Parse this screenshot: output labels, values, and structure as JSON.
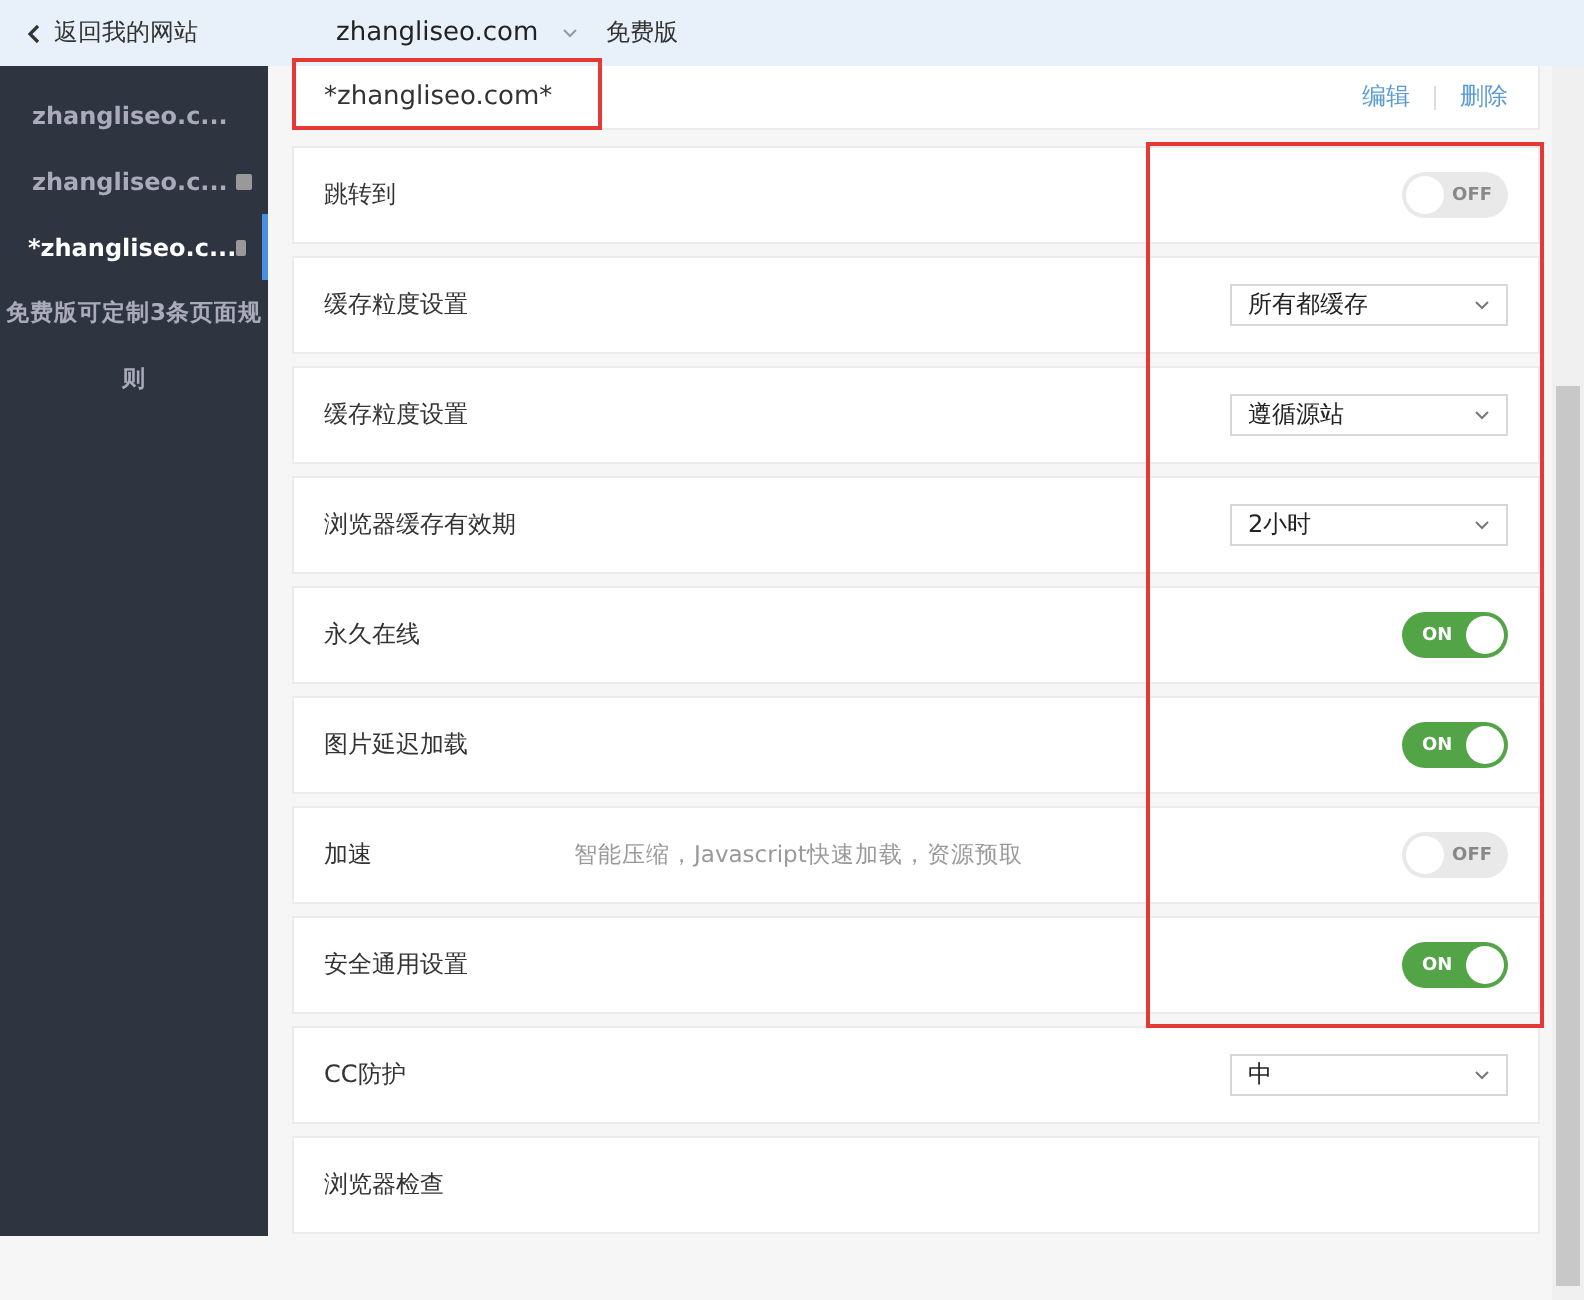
{
  "top_bar": {
    "back_link": "返回我的网站",
    "site": "zhangliseo.com",
    "plan": "免费版"
  },
  "sidebar": {
    "items": [
      {
        "label": "zhangliseo.c...",
        "selected": false,
        "has_icon": false
      },
      {
        "label": "zhangliseo.c...",
        "selected": false,
        "has_icon": true
      },
      {
        "label": "*zhangliseo.c...",
        "selected": true,
        "has_icon": true
      }
    ],
    "note": "免费版可定制3条页面规则"
  },
  "rule": {
    "title": "*zhangliseo.com*",
    "actions": [
      "编辑",
      "删除"
    ]
  },
  "settings": [
    {
      "kind": "toggle",
      "label": "跳转到",
      "on": false,
      "state_text": "OFF"
    },
    {
      "kind": "select",
      "label": "缓存粒度设置",
      "value": "所有都缓存"
    },
    {
      "kind": "select",
      "label": "缓存粒度设置",
      "value": "遵循源站"
    },
    {
      "kind": "select",
      "label": "浏览器缓存有效期",
      "value": "2小时"
    },
    {
      "kind": "toggle",
      "label": "永久在线",
      "on": true,
      "state_text": "ON"
    },
    {
      "kind": "toggle",
      "label": "图片延迟加载",
      "on": true,
      "state_text": "ON"
    },
    {
      "kind": "toggle",
      "label": "加速",
      "hint": "智能压缩，Javascript快速加载，资源预取",
      "on": false,
      "state_text": "OFF"
    },
    {
      "kind": "toggle",
      "label": "安全通用设置",
      "on": true,
      "state_text": "ON"
    },
    {
      "kind": "select",
      "label": "CC防护",
      "value": "中"
    },
    {
      "kind": "plain",
      "label": "浏览器检查"
    }
  ]
}
